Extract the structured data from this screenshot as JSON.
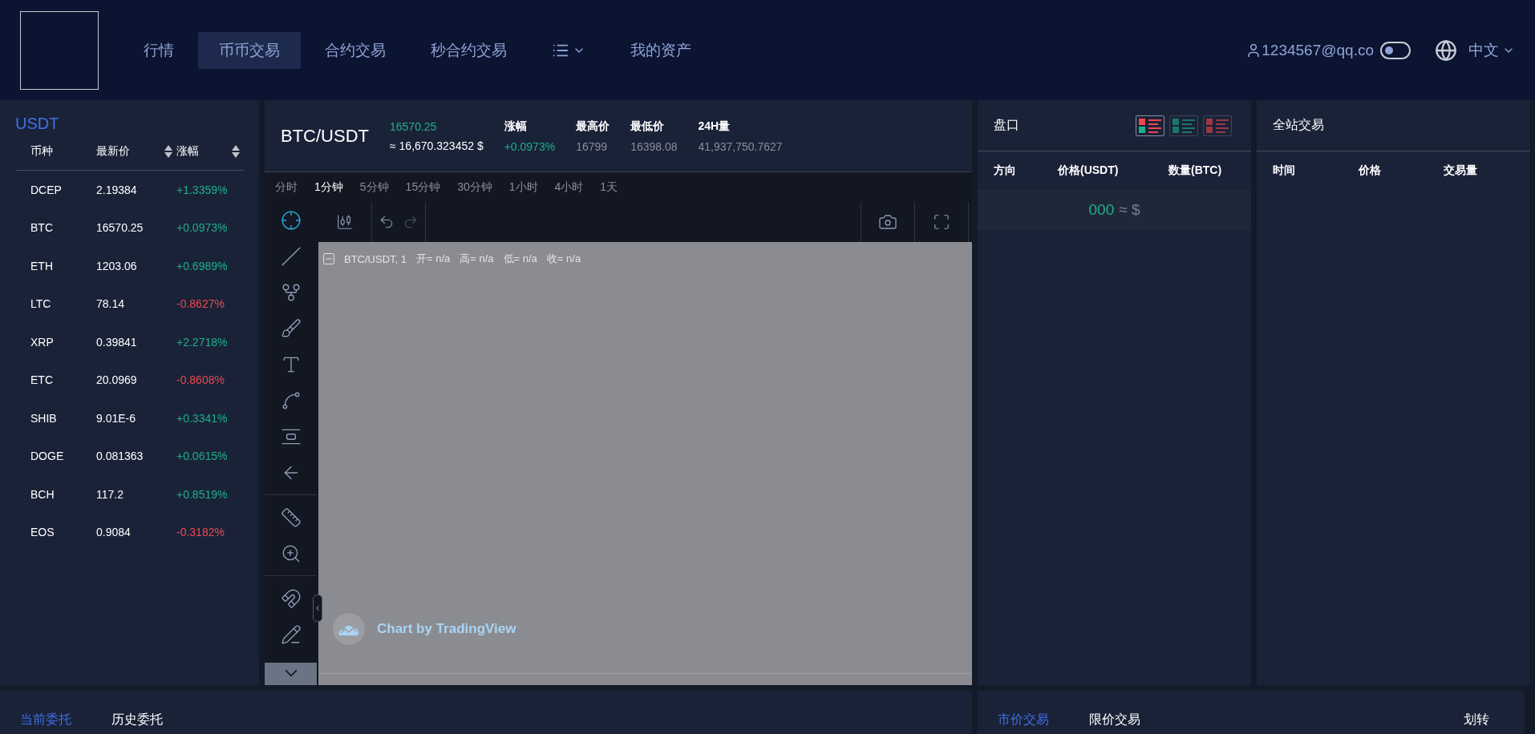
{
  "header": {
    "nav": [
      {
        "kind": "link",
        "label": "行情",
        "selected": false
      },
      {
        "kind": "link",
        "label": "币币交易",
        "selected": true
      },
      {
        "kind": "link",
        "label": "合约交易",
        "selected": false
      },
      {
        "kind": "link",
        "label": "秒合约交易",
        "selected": false
      },
      {
        "kind": "menu",
        "selected": false
      },
      {
        "kind": "link",
        "label": "我的资产",
        "selected": false
      }
    ],
    "user": "1234567@qq.co",
    "theme_toggle": {
      "on": false
    },
    "language": "中文"
  },
  "market": {
    "title": "USDT",
    "columns": [
      {
        "label": "币种",
        "sortable": false
      },
      {
        "label": "最新价",
        "sortable": true
      },
      {
        "label": "涨幅",
        "sortable": true
      }
    ],
    "rows": [
      {
        "symbol": "DCEP",
        "price": "2.19384",
        "change": "+1.3359%",
        "color": "#1db18a"
      },
      {
        "symbol": "BTC",
        "price": "16570.25",
        "change": "+0.0973%",
        "color": "#1db18a"
      },
      {
        "symbol": "ETH",
        "price": "1203.06",
        "change": "+0.6989%",
        "color": "#1db18a"
      },
      {
        "symbol": "LTC",
        "price": "78.14",
        "change": "-0.8627%",
        "color": "#f0474f"
      },
      {
        "symbol": "XRP",
        "price": "0.39841",
        "change": "+2.2718%",
        "color": "#1db18a"
      },
      {
        "symbol": "ETC",
        "price": "20.0969",
        "change": "-0.8608%",
        "color": "#f0474f"
      },
      {
        "symbol": "SHIB",
        "price": "9.01E-6",
        "change": "+0.3341%",
        "color": "#1db18a"
      },
      {
        "symbol": "DOGE",
        "price": "0.081363",
        "change": "+0.0615%",
        "color": "#1db18a"
      },
      {
        "symbol": "BCH",
        "price": "117.2",
        "change": "+0.8519%",
        "color": "#1db18a"
      },
      {
        "symbol": "EOS",
        "price": "0.9084",
        "change": "-0.3182%",
        "color": "#f0474f"
      }
    ]
  },
  "chart": {
    "pair": "BTC/USDT",
    "price": "16570.25",
    "approx": "≈ 16,670.323452 $",
    "stats": [
      {
        "label": "涨幅",
        "value": "+0.0973%",
        "color": "#1db18a"
      },
      {
        "label": "最高价",
        "value": "16799",
        "color": "#8a8f9c"
      },
      {
        "label": "最低价",
        "value": "16398.08",
        "color": "#8a8f9c"
      },
      {
        "label": "24H量",
        "value": "41,937,750.7627",
        "color": "#8a8f9c"
      }
    ],
    "intervals": [
      {
        "label": "分时",
        "selected": false
      },
      {
        "label": "1分钟",
        "selected": true
      },
      {
        "label": "5分钟",
        "selected": false
      },
      {
        "label": "15分钟",
        "selected": false
      },
      {
        "label": "30分钟",
        "selected": false
      },
      {
        "label": "1小时",
        "selected": false
      },
      {
        "label": "4小时",
        "selected": false
      },
      {
        "label": "1天",
        "selected": false
      }
    ],
    "legend": {
      "symbol": "BTC/USDT, 1",
      "fields": [
        "开= n/a",
        "高= n/a",
        "低= n/a",
        "收= n/a"
      ]
    },
    "attribution": "Chart by TradingView"
  },
  "orderbook": {
    "title": "盘口",
    "views": [
      {
        "kind": "both",
        "selected": true
      },
      {
        "kind": "bids",
        "selected": false
      },
      {
        "kind": "asks",
        "selected": false
      }
    ],
    "columns": [
      "方向",
      "价格(USDT)",
      "数量(BTC)"
    ],
    "mid_price": "000",
    "mid_approx": "≈ $"
  },
  "trades": {
    "title": "全站交易",
    "columns": [
      "时间",
      "价格",
      "交易量"
    ]
  },
  "orders": {
    "tabs": [
      {
        "label": "当前委托",
        "selected": true
      },
      {
        "label": "历史委托",
        "selected": false
      }
    ]
  },
  "trade_form": {
    "tabs": [
      {
        "label": "市价交易",
        "selected": true
      },
      {
        "label": "限价交易",
        "selected": false
      }
    ],
    "transfer": "划转"
  }
}
